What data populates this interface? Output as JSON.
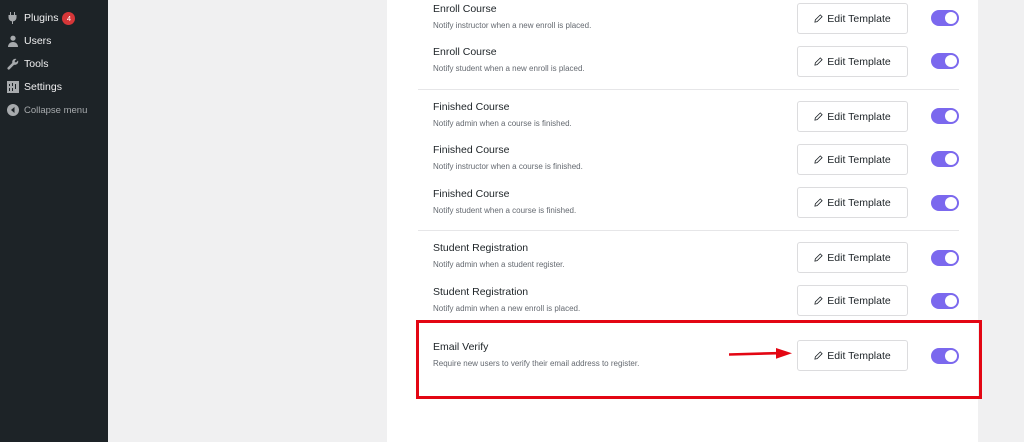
{
  "sidebar": {
    "items": [
      {
        "label": "Plugins",
        "icon": "plug-icon",
        "badge": "4"
      },
      {
        "label": "Users",
        "icon": "user-icon"
      },
      {
        "label": "Tools",
        "icon": "wrench-icon"
      },
      {
        "label": "Settings",
        "icon": "settings-icon"
      },
      {
        "label": "Collapse menu",
        "icon": "collapse-icon"
      }
    ]
  },
  "notifications": [
    {
      "title": "Enroll Course",
      "desc": "Notify instructor when a new enroll is placed.",
      "button": "Edit Template",
      "enabled": true
    },
    {
      "title": "Enroll Course",
      "desc": "Notify student when a new enroll is placed.",
      "button": "Edit Template",
      "enabled": true
    },
    {
      "title": "Finished Course",
      "desc": "Notify admin when a course is finished.",
      "button": "Edit Template",
      "enabled": true
    },
    {
      "title": "Finished Course",
      "desc": "Notify instructor when a course is finished.",
      "button": "Edit Template",
      "enabled": true
    },
    {
      "title": "Finished Course",
      "desc": "Notify student when a course is finished.",
      "button": "Edit Template",
      "enabled": true
    },
    {
      "title": "Student Registration",
      "desc": "Notify admin when a student register.",
      "button": "Edit Template",
      "enabled": true
    },
    {
      "title": "Student Registration",
      "desc": "Notify admin when a new enroll is placed.",
      "button": "Edit Template",
      "enabled": true
    },
    {
      "title": "Email Verify",
      "desc": "Require new users to verify their email address to register.",
      "button": "Edit Template",
      "enabled": true
    }
  ],
  "colors": {
    "accent": "#7b68ee",
    "highlight": "#e30613",
    "sidebar_bg": "#1d2327",
    "badge": "#d63638"
  }
}
